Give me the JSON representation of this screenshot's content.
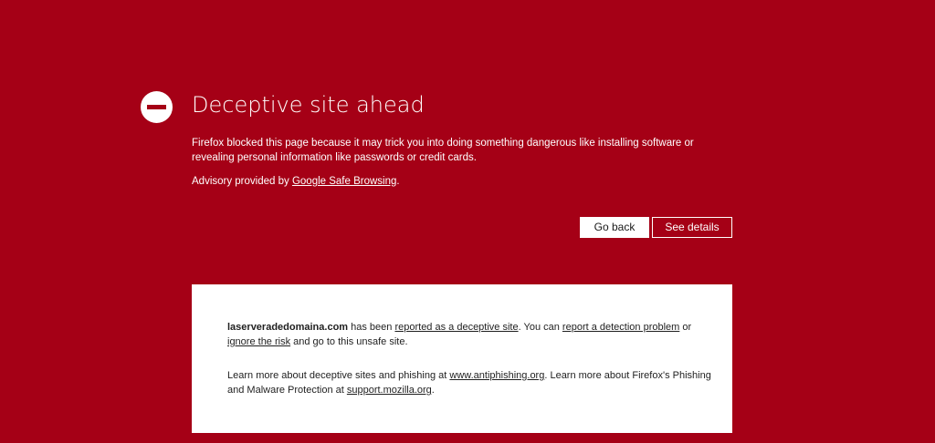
{
  "error": {
    "title": "Deceptive site ahead",
    "description": "Firefox blocked this page because it may trick you into doing something dangerous like installing software or revealing personal information like passwords or credit cards.",
    "advisory_prefix": "Advisory provided by ",
    "advisory_link": "Google Safe Browsing",
    "advisory_suffix": ".",
    "icon": "blocked-icon"
  },
  "buttons": {
    "go_back": "Go back",
    "see_details": "See details"
  },
  "details": {
    "domain": "laserveradedomaina.com",
    "p1_text1": " has been ",
    "p1_link1": "reported as a deceptive site",
    "p1_text2": ". You can ",
    "p1_link2": "report a detection problem",
    "p1_text3": " or ",
    "p1_link3": "ignore the risk",
    "p1_text4": " and go to this unsafe site.",
    "p2_text1": "Learn more about deceptive sites and phishing at ",
    "p2_link1": "www.antiphishing.org",
    "p2_text2": ". Learn more about Firefox's Phishing and Malware Protection at ",
    "p2_link2": "support.mozilla.org",
    "p2_text3": "."
  },
  "colors": {
    "background": "#a50016",
    "card": "#ffffff"
  }
}
